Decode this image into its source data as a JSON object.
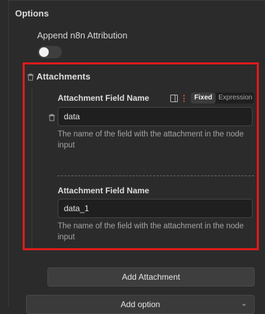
{
  "options": {
    "title": "Options",
    "append_label": "Append n8n Attribution",
    "append_enabled": false
  },
  "attachments": {
    "title": "Attachments",
    "fields": [
      {
        "label": "Attachment Field Name",
        "value": "data",
        "hint": "The name of the field with the attachment in the node input"
      },
      {
        "label": "Attachment Field Name",
        "value": "data_1",
        "hint": "The name of the field with the attachment in the node input"
      }
    ],
    "mode": {
      "fixed": "Fixed",
      "expression": "Expression",
      "selected": "Fixed"
    }
  },
  "buttons": {
    "add_attachment": "Add Attachment",
    "add_option": "Add option"
  },
  "colors": {
    "highlight_border": "#e01b1b",
    "background": "#2b2b2b",
    "input_background": "#1f1f1f"
  },
  "icons": [
    "trash-icon",
    "panel-icon",
    "more-vertical-icon",
    "chevron-down-icon"
  ]
}
